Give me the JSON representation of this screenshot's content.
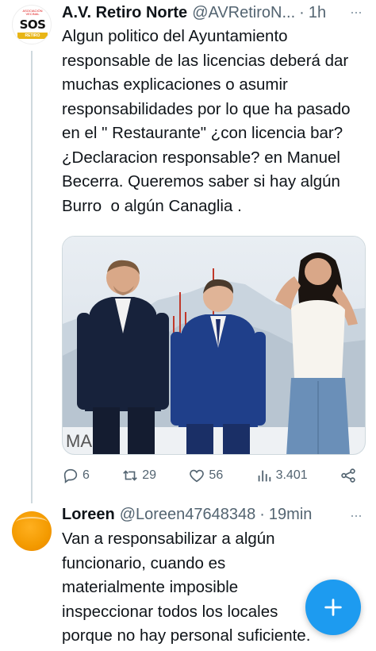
{
  "tweets": [
    {
      "author_name": "A.V. Retiro Norte",
      "author_handle": "@AVRetiroN...",
      "time": "1h",
      "text": "Algun politico del Ayuntamiento responsable de las licencias deberá dar muchas explicaciones o asumir responsabilidades por lo que ha pasado en el \" Restaurante\" ¿con licencia bar? ¿Declaracion responsable? en Manuel Becerra. Queremos saber si hay algún Burro  o algún Canaglia .",
      "avatar": {
        "icon": "sos-retiro-logo",
        "top_text": "ASOCIACIÓN VECINAL",
        "logo_text": "SOS",
        "bar_text": "RETIRO"
      },
      "media_alt": "Photo of three people standing in front of a Madrid skyline backdrop",
      "stats": {
        "replies": "6",
        "retweets": "29",
        "likes": "56",
        "views": "3.401"
      }
    },
    {
      "author_name": "Loreen",
      "author_handle": "@Loreen47648348",
      "time": "19min",
      "text": "Van a responsabilizar a algún funcionario, cuando es materialmente imposible inspeccionar todos los locales porque no hay personal suficiente."
    }
  ],
  "separator": "·",
  "more_icon": "···",
  "colors": {
    "accent": "#1d9bf0",
    "secondary_text": "#536471",
    "thread_line": "#cfd9de"
  }
}
